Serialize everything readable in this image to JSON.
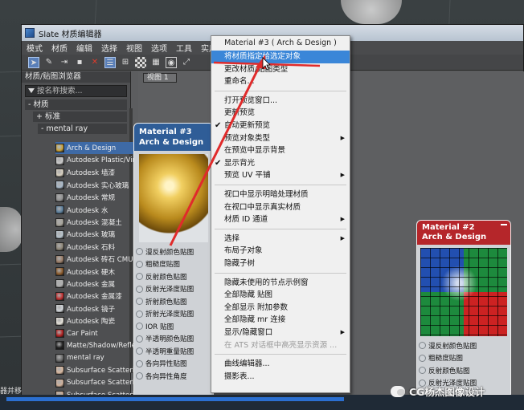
{
  "window": {
    "title": "Slate 材质编辑器"
  },
  "menubar": [
    "模式",
    "材质",
    "编辑",
    "选择",
    "视图",
    "选项",
    "工具",
    "实用"
  ],
  "toolbar": {
    "icons": [
      "select-arrow-icon",
      "eyedropper-icon",
      "assign-icon",
      "paint-icon",
      "delete-icon",
      "layout-icon",
      "layout-children-icon",
      "checker-icon",
      "background-icon",
      "preview-icon",
      "fit-icon"
    ]
  },
  "browser": {
    "title": "材质/贴图浏览器",
    "search_placeholder": "按名称搜索...",
    "rollouts": {
      "materials": "- 材质",
      "standard": "+ 标准",
      "mental_ray": "- mental ray"
    },
    "items": [
      {
        "label": "Arch & Design",
        "color": "#c9a23a",
        "selected": true
      },
      {
        "label": "Autodesk Plastic/Vinyl",
        "color": "#c8c8c8"
      },
      {
        "label": "Autodesk 墙漆",
        "color": "#d8d0c0"
      },
      {
        "label": "Autodesk 实心玻璃",
        "color": "#a8b8c8"
      },
      {
        "label": "Autodesk 常规",
        "color": "#909090"
      },
      {
        "label": "Autodesk 水",
        "color": "#5c7f9c"
      },
      {
        "label": "Autodesk 混凝土",
        "color": "#a6a39a"
      },
      {
        "label": "Autodesk 玻璃",
        "color": "#b7c3cc"
      },
      {
        "label": "Autodesk 石料",
        "color": "#8d8577"
      },
      {
        "label": "Autodesk 砖石 CMU",
        "color": "#9a7d68"
      },
      {
        "label": "Autodesk 硬木",
        "color": "#8b5a2b"
      },
      {
        "label": "Autodesk 金属",
        "color": "#b0b0b0"
      },
      {
        "label": "Autodesk 金属漆",
        "color": "#c03030"
      },
      {
        "label": "Autodesk 镜子",
        "color": "#d0d4d8"
      },
      {
        "label": "Autodesk 陶瓷",
        "color": "#e6e2da"
      },
      {
        "label": "Car Paint",
        "color": "#b02020"
      },
      {
        "label": "Matte/Shadow/Refle...",
        "color": "#222222"
      },
      {
        "label": "mental ray",
        "color": "#6a6a6a"
      },
      {
        "label": "Subsurface Scatteri...",
        "color": "#d8b8a0"
      },
      {
        "label": "Subsurface Scatteri...",
        "color": "#cfb09a"
      },
      {
        "label": "Subsurface Scatteri...",
        "color": "#c6a891"
      }
    ]
  },
  "view": {
    "tab": "视图 1"
  },
  "node3": {
    "title_line1": "Material #3",
    "title_line2": "Arch & Design",
    "slots": [
      "漫反射颜色贴图",
      "粗糙度贴图",
      "反射颜色贴图",
      "反射光泽度贴图",
      "折射颜色贴图",
      "折射光泽度贴图",
      "IOR 贴图",
      "半透明颜色贴图",
      "半透明重量贴图",
      "各向异性贴图",
      "各向异性角度"
    ]
  },
  "node2": {
    "title_line1": "Material #2",
    "title_line2": "Arch & Design",
    "slots": [
      "漫反射颜色贴图",
      "粗糙度贴图",
      "反射颜色贴图",
      "反射光泽度贴图"
    ]
  },
  "context_menu": {
    "title": "Material #3 ( Arch & Design )",
    "items": [
      {
        "label": "将材质指定给选定对象",
        "highlight": true
      },
      {
        "label": "更改材质/贴图类型"
      },
      {
        "label": "重命名..."
      },
      {
        "label": "打开预览窗口..."
      },
      {
        "label": "更新预览"
      },
      {
        "label": "自动更新预览",
        "checked": true
      },
      {
        "label": "预览对象类型",
        "submenu": true
      },
      {
        "label": "在预览中显示背景"
      },
      {
        "label": "显示背光",
        "checked": true
      },
      {
        "label": "预览 UV 平铺",
        "submenu": true
      },
      {
        "label": "视口中显示明暗处理材质"
      },
      {
        "label": "在视口中显示真实材质"
      },
      {
        "label": "材质 ID 通道",
        "submenu": true
      },
      {
        "label": "选择",
        "submenu": true
      },
      {
        "label": "布局子对象"
      },
      {
        "label": "隐藏子树"
      },
      {
        "label": "隐藏未使用的节点示例窗"
      },
      {
        "label": "全部隐藏 贴图"
      },
      {
        "label": "全部显示 附加参数"
      },
      {
        "label": "全部隐藏 mr 连接"
      },
      {
        "label": "显示/隐藏窗口",
        "submenu": true
      },
      {
        "label": "在 ATS 对话框中高亮显示资源 ...",
        "disabled": true
      },
      {
        "label": "曲线编辑器..."
      },
      {
        "label": "摄影表..."
      }
    ]
  },
  "bottom": {
    "left_text": "器并移"
  },
  "watermark": {
    "text": "CG杨杰图像设计"
  },
  "colors": {
    "highlight": "#3a86d8",
    "node3_header": "#2f5d97",
    "node2_header": "#b5262a",
    "annotation": "#e02b2b"
  }
}
